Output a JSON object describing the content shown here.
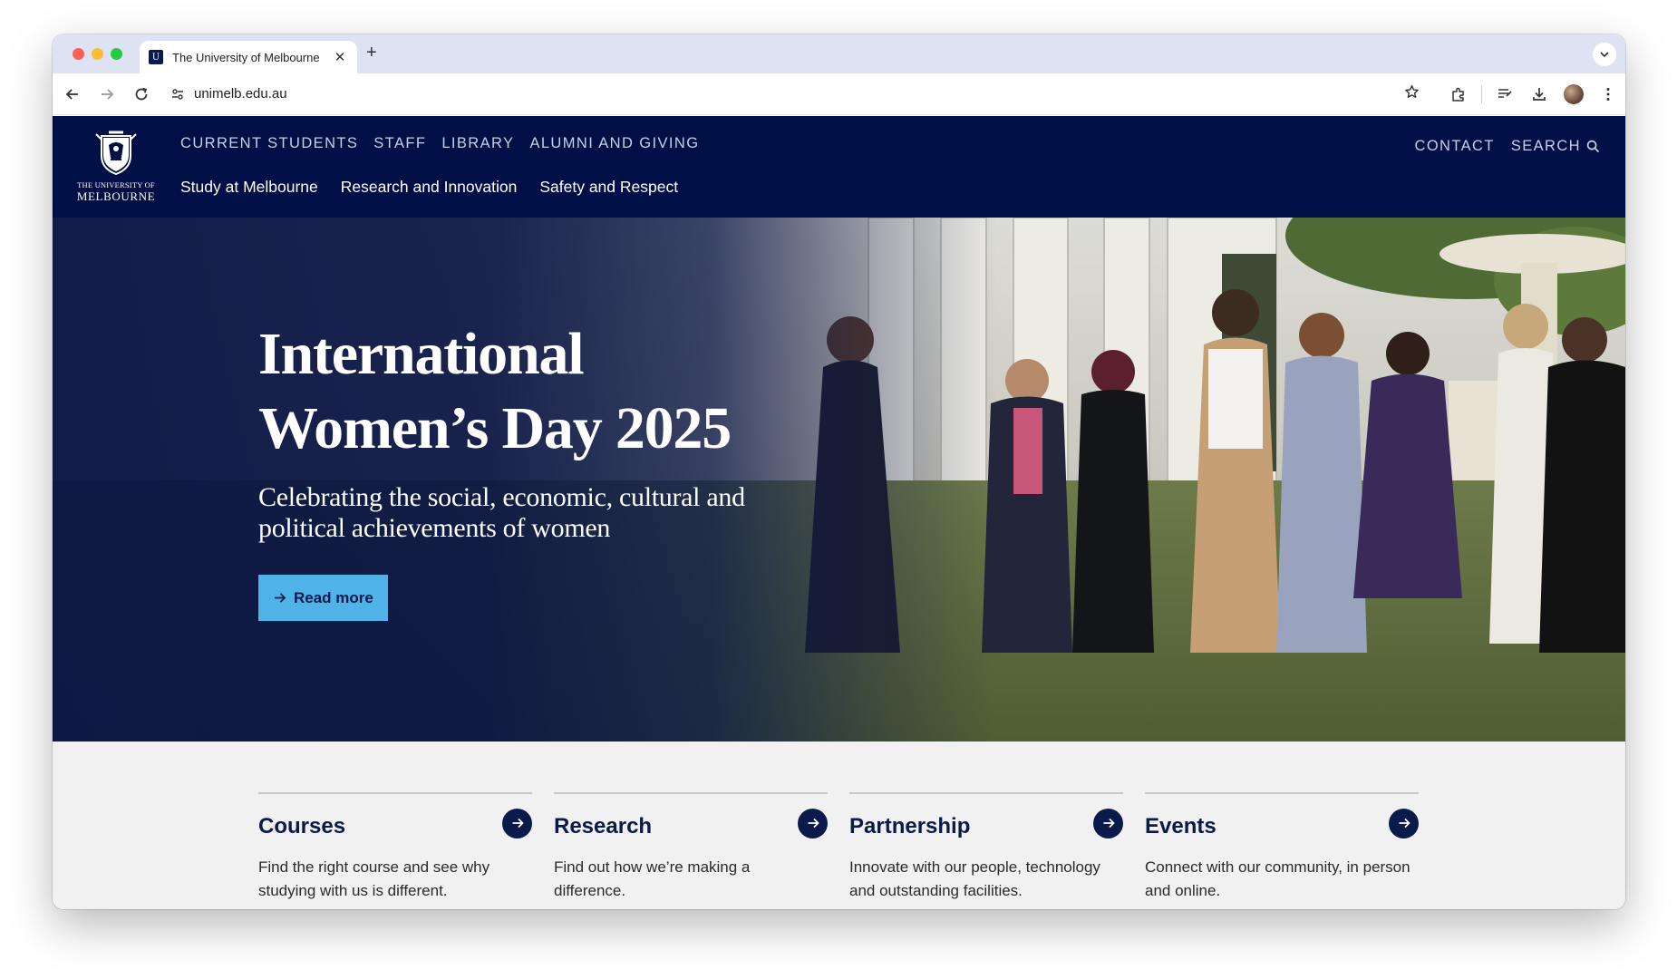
{
  "browser": {
    "tab_title": "The University of Melbourne",
    "url": "unimelb.edu.au",
    "favicon_glyph": "U"
  },
  "header": {
    "logo_line1": "THE UNIVERSITY OF",
    "logo_line2": "MELBOURNE",
    "utility_nav": [
      "CURRENT STUDENTS",
      "STAFF",
      "LIBRARY",
      "ALUMNI AND GIVING"
    ],
    "main_nav": [
      "Study at Melbourne",
      "Research and Innovation",
      "Safety and Respect"
    ],
    "contact": "CONTACT",
    "search": "SEARCH"
  },
  "hero": {
    "title_line1": "International",
    "title_line2": "Women’s Day 2025",
    "subtitle_line1": "Celebrating the social, economic, cultural and",
    "subtitle_line2": "political achievements of women",
    "button": "Read more"
  },
  "cards": [
    {
      "title": "Courses",
      "line1": "Find the right course and see why",
      "line2": "studying with us is different."
    },
    {
      "title": "Research",
      "line1": "Find out how we’re making a",
      "line2": "difference."
    },
    {
      "title": "Partnership",
      "line1": "Innovate with our people, technology",
      "line2": "and outstanding facilities."
    },
    {
      "title": "Events",
      "line1": "Connect with our community, in person",
      "line2": "and online."
    }
  ],
  "colors": {
    "brand_navy": "#000f46",
    "button_blue": "#4fb3e8",
    "card_bg": "#f1f1f1"
  }
}
